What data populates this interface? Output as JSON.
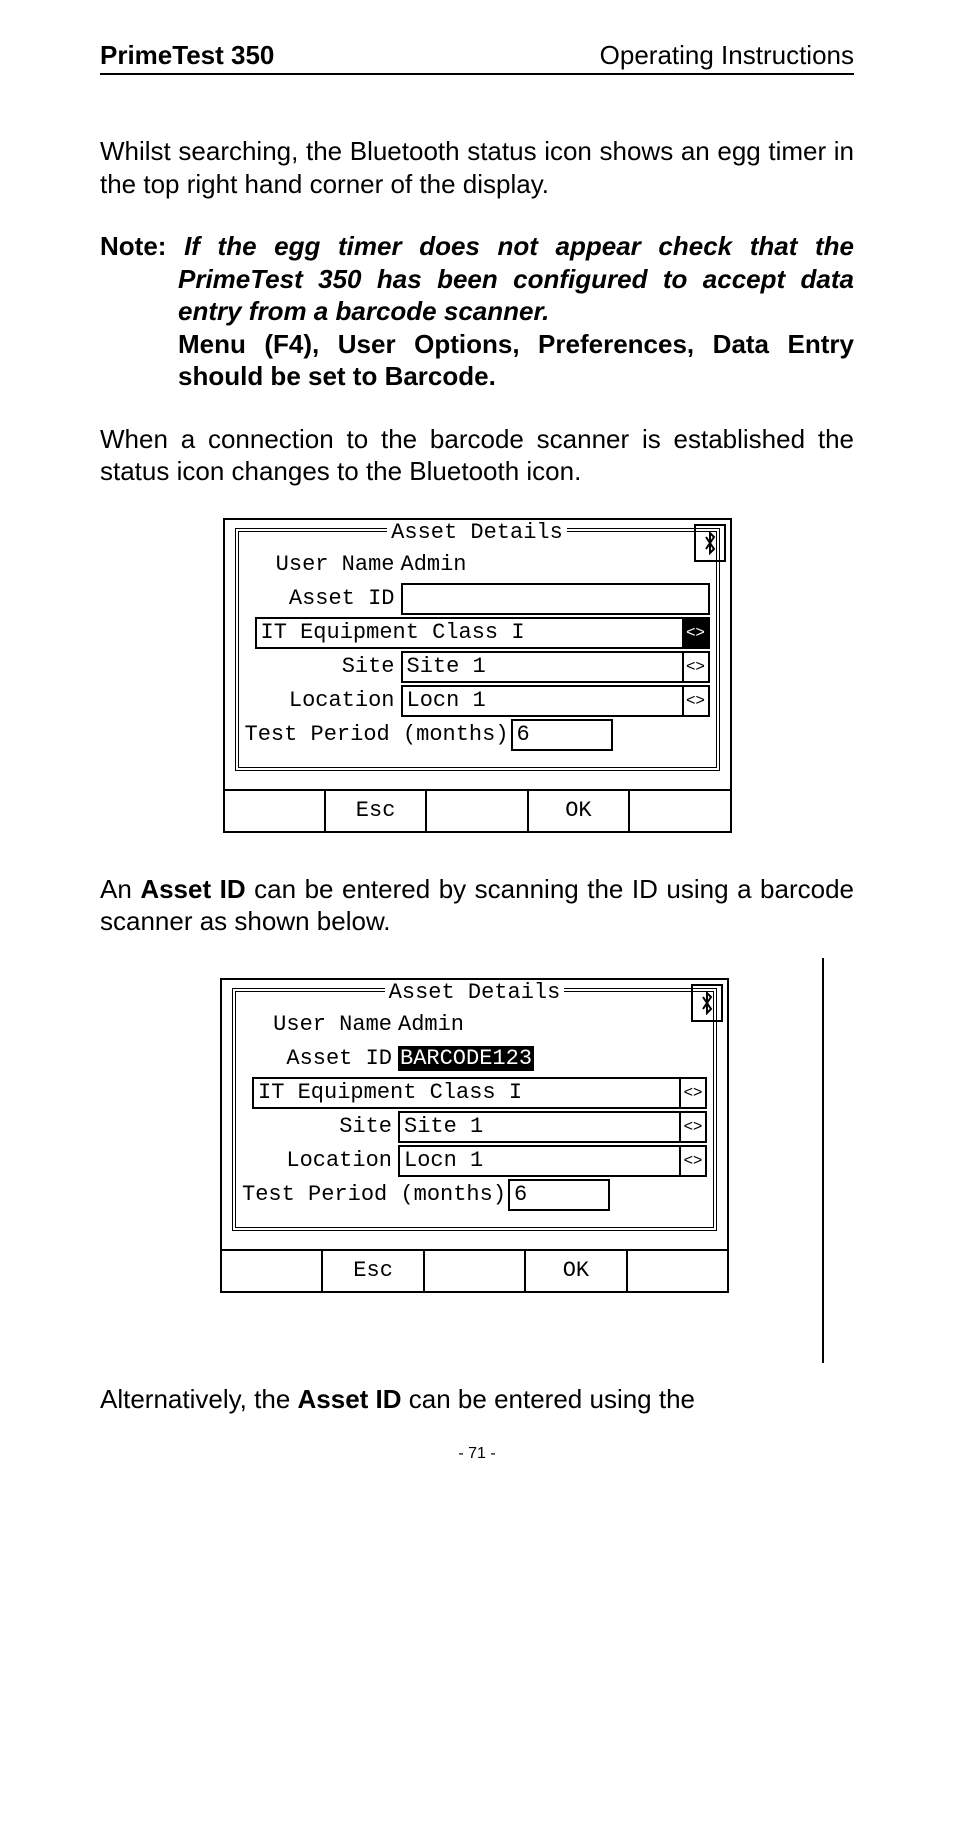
{
  "header": {
    "left": "PrimeTest 350",
    "right": "Operating Instructions"
  },
  "para1": "Whilst searching, the Bluetooth status icon shows an egg timer in the top right hand corner of the display.",
  "note": {
    "label": "Note:",
    "italic": "If the egg timer does not appear check that the PrimeTest 350 has been configured to accept data entry from a barcode scanner.",
    "bold": "Menu (F4), User Options, Preferences, Data Entry should be set to Barcode."
  },
  "para2": "When a connection to the barcode scanner is established the status icon changes to the Bluetooth icon.",
  "screen1": {
    "title": "Asset Details",
    "username_label": "User Name",
    "username_value": "Admin",
    "assetid_label": "Asset ID",
    "assetid_value": "",
    "equipment_value": "IT Equipment Class I",
    "equipment_selected": true,
    "site_label": "Site",
    "site_value": "Site 1",
    "location_label": "Location",
    "location_value": "Locn 1",
    "testperiod_label": "Test Period (months)",
    "testperiod_value": "6",
    "softkeys": [
      "",
      "Esc",
      "",
      "OK",
      ""
    ]
  },
  "para3_pre": "An ",
  "para3_bold": "Asset ID",
  "para3_post": " can be entered by scanning the ID using a barcode scanner as shown below.",
  "screen2": {
    "title": "Asset Details",
    "username_label": "User Name",
    "username_value": "Admin",
    "assetid_label": "Asset ID",
    "assetid_value": "BARCODE123",
    "equipment_value": "IT Equipment Class I",
    "equipment_selected": false,
    "site_label": "Site",
    "site_value": "Site 1",
    "location_label": "Location",
    "location_value": "Locn 1",
    "testperiod_label": "Test Period (months)",
    "testperiod_value": "6",
    "softkeys": [
      "",
      "Esc",
      "",
      "OK",
      ""
    ]
  },
  "para4_pre": "Alternatively, the ",
  "para4_bold": "Asset ID",
  "para4_post": " can be entered using the",
  "page_number": "- 71 -"
}
